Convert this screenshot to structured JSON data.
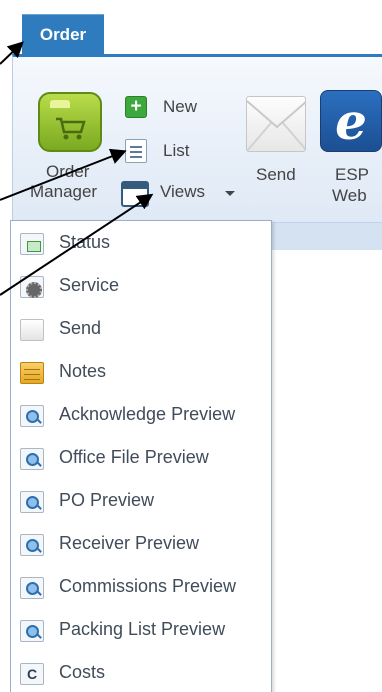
{
  "tab": {
    "label": "Order"
  },
  "ribbon": {
    "order_manager": {
      "line1": "Order",
      "line2": "Manager"
    },
    "new_label": "New",
    "list_label": "List",
    "views_label": "Views",
    "send_label": "Send",
    "esp": {
      "line1": "ESP",
      "line2": "Web",
      "glyph": "e"
    }
  },
  "menu": {
    "items": [
      {
        "label": "Status",
        "icon": "status-icon"
      },
      {
        "label": "Service",
        "icon": "service-icon"
      },
      {
        "label": "Send",
        "icon": "envelope-icon"
      },
      {
        "label": "Notes",
        "icon": "notes-icon"
      },
      {
        "label": "Acknowledge Preview",
        "icon": "preview-icon"
      },
      {
        "label": "Office File Preview",
        "icon": "preview-icon"
      },
      {
        "label": "PO Preview",
        "icon": "preview-icon"
      },
      {
        "label": "Receiver Preview",
        "icon": "preview-icon"
      },
      {
        "label": "Commissions Preview",
        "icon": "preview-icon"
      },
      {
        "label": "Packing List Preview",
        "icon": "preview-icon"
      },
      {
        "label": "Costs",
        "icon": "costs-icon",
        "glyph": "C"
      }
    ]
  },
  "colors": {
    "accent": "#2e7bbd",
    "ribbon_bg": "#e6eef8",
    "menu_text": "#404c5a"
  }
}
